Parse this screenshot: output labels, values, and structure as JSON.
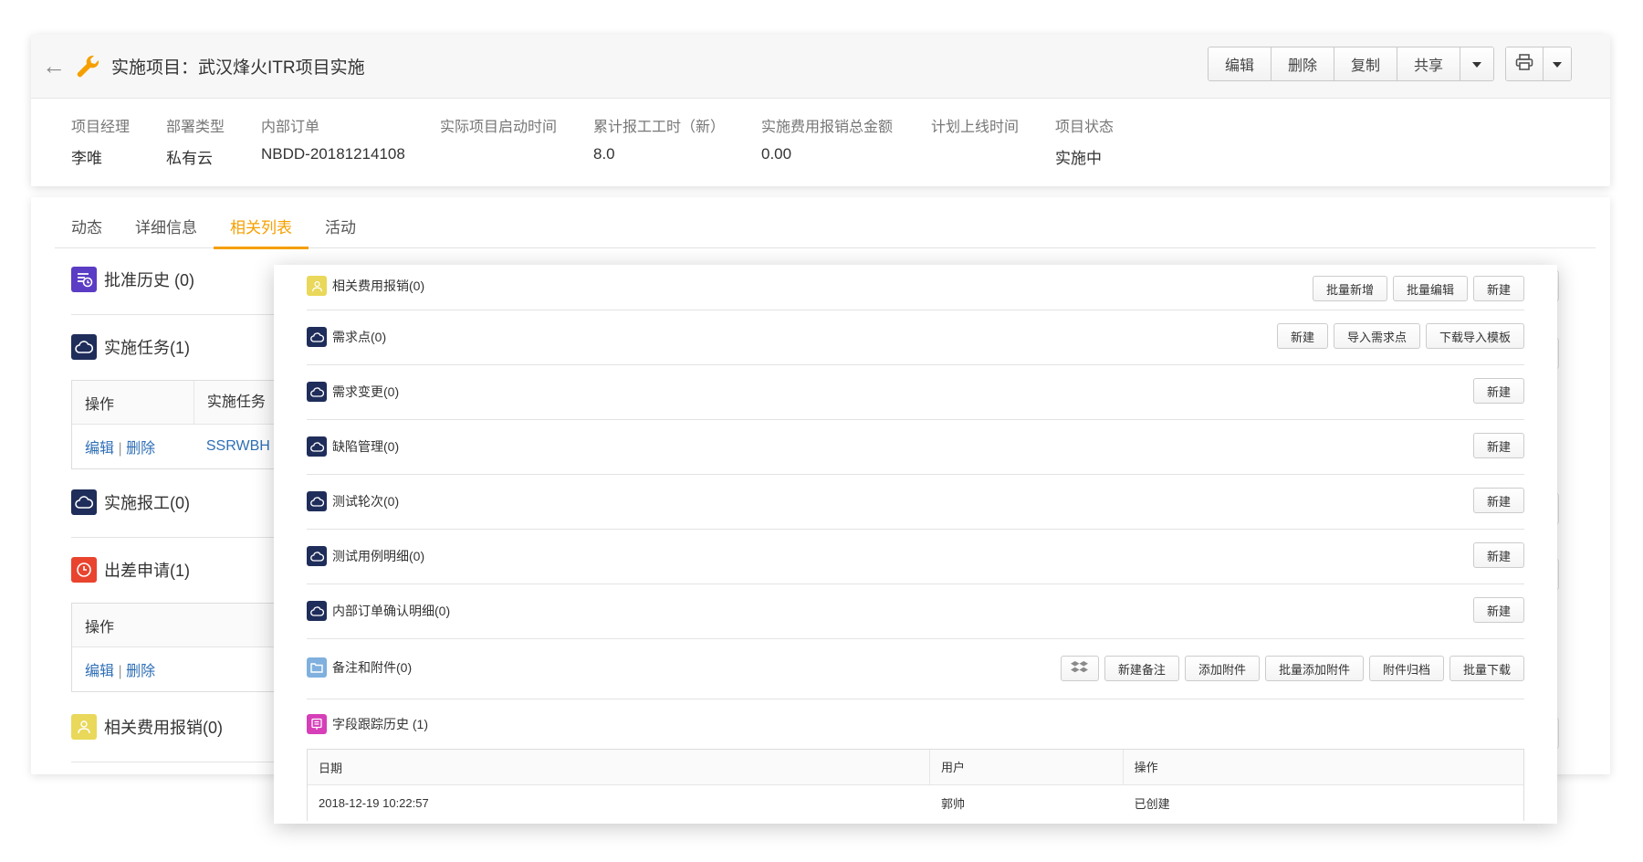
{
  "header": {
    "title": "实施项目：武汉烽火ITR项目实施",
    "icons": {
      "back": "back-arrow-icon",
      "object": "wrench-icon"
    },
    "toolbar": {
      "edit": "编辑",
      "delete": "删除",
      "copy": "复制",
      "share": "共享",
      "more_icon": "caret-down-icon",
      "print_icon": "printer-icon"
    },
    "fields": [
      {
        "label": "项目经理",
        "value": "李唯"
      },
      {
        "label": "部署类型",
        "value": "私有云"
      },
      {
        "label": "内部订单",
        "value": "NBDD-20181214108"
      },
      {
        "label": "实际项目启动时间",
        "value": ""
      },
      {
        "label": "累计报工工时（新）",
        "value": "8.0"
      },
      {
        "label": "实施费用报销总金额",
        "value": "0.00"
      },
      {
        "label": "计划上线时间",
        "value": ""
      },
      {
        "label": "项目状态",
        "value": "实施中"
      }
    ]
  },
  "tabs": [
    {
      "label": "动态",
      "active": false
    },
    {
      "label": "详细信息",
      "active": false
    },
    {
      "label": "相关列表",
      "active": true
    },
    {
      "label": "活动",
      "active": false
    }
  ],
  "left_sections": {
    "approval_history": "批准历史 (0)",
    "impl_tasks": "实施任务(1)",
    "impl_tasks_table": {
      "columns": [
        "操作",
        "实施任务"
      ],
      "row": {
        "edit": "编辑",
        "sep": " | ",
        "delete": "删除",
        "code": "SSRWBH"
      }
    },
    "work_report": "实施报工(0)",
    "trip_request": "出差申请(1)",
    "trip_table": {
      "columns": [
        "操作"
      ],
      "row": {
        "edit": "编辑",
        "sep": " | ",
        "delete": "删除"
      }
    },
    "expense": "相关费用报销(0)"
  },
  "overlay": {
    "sections": [
      {
        "title": "相关费用报销(0)",
        "icon": "person-icon",
        "actions": [
          "批量新增",
          "批量编辑",
          "新建"
        ]
      },
      {
        "title": "需求点(0)",
        "icon": "cloud-icon",
        "actions": [
          "新建",
          "导入需求点",
          "下载导入模板"
        ]
      },
      {
        "title": "需求变更(0)",
        "icon": "cloud-icon",
        "actions": [
          "新建"
        ]
      },
      {
        "title": "缺陷管理(0)",
        "icon": "cloud-icon",
        "actions": [
          "新建"
        ]
      },
      {
        "title": "测试轮次(0)",
        "icon": "cloud-icon",
        "actions": [
          "新建"
        ]
      },
      {
        "title": "测试用例明细(0)",
        "icon": "cloud-icon",
        "actions": [
          "新建"
        ]
      },
      {
        "title": "内部订单确认明细(0)",
        "icon": "cloud-icon",
        "actions": [
          "新建"
        ]
      },
      {
        "title": "备注和附件(0)",
        "icon": "folder-icon",
        "actions": [
          "新建备注",
          "添加附件",
          "批量添加附件",
          "附件归档",
          "批量下载"
        ]
      }
    ],
    "history": {
      "title": "字段跟踪历史 (1)",
      "columns": [
        "日期",
        "用户",
        "操作"
      ],
      "rows": [
        [
          "2018-12-19 10:22:57",
          "郭帅",
          "已创建"
        ]
      ]
    }
  },
  "colors": {
    "accent": "#f5a000",
    "link": "#2f6fb6",
    "navy_icon": "#1f2d5a",
    "purple_icon": "#5b3cc4",
    "red_icon": "#e8442e",
    "yellow_icon": "#e9d85a",
    "pink_icon": "#d63fb8",
    "folder_icon": "#7fb0de"
  }
}
